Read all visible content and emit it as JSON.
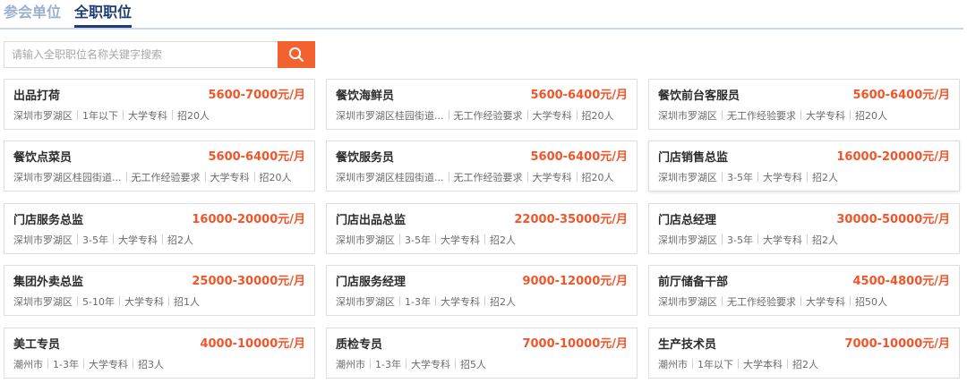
{
  "tabs": [
    {
      "label": "参会单位",
      "active": false
    },
    {
      "label": "全职职位",
      "active": true
    }
  ],
  "search": {
    "placeholder": "请输入全职职位名称关键字搜索",
    "icon": "search-icon"
  },
  "colors": {
    "accent": "#f2612f",
    "salary": "#f0562a",
    "tab_active": "#1f3d73",
    "tab_inactive": "#9bb0cf"
  },
  "jobs": [
    {
      "title": "出品打荷",
      "salary": "5600-7000元/月",
      "location": "深圳市罗湖区",
      "experience": "1年以下",
      "education": "大学专科",
      "headcount": "招20人"
    },
    {
      "title": "餐饮海鲜员",
      "salary": "5600-6400元/月",
      "location": "深圳市罗湖区桂园街道...",
      "experience": "无工作经验要求",
      "education": "大学专科",
      "headcount": "招20人"
    },
    {
      "title": "餐饮前台客服员",
      "salary": "5600-6400元/月",
      "location": "深圳市罗湖区",
      "experience": "无工作经验要求",
      "education": "大学专科",
      "headcount": "招20人"
    },
    {
      "title": "餐饮点菜员",
      "salary": "5600-6400元/月",
      "location": "深圳市罗湖区桂园街道...",
      "experience": "无工作经验要求",
      "education": "大学专科",
      "headcount": "招20人"
    },
    {
      "title": "餐饮服务员",
      "salary": "5600-6400元/月",
      "location": "深圳市罗湖区桂园街道...",
      "experience": "无工作经验要求",
      "education": "大学专科",
      "headcount": "招20人"
    },
    {
      "title": "门店销售总监",
      "salary": "16000-20000元/月",
      "location": "深圳市罗湖区",
      "experience": "3-5年",
      "education": "大学专科",
      "headcount": "招2人"
    },
    {
      "title": "门店服务总监",
      "salary": "16000-20000元/月",
      "location": "深圳市罗湖区",
      "experience": "3-5年",
      "education": "大学专科",
      "headcount": "招2人"
    },
    {
      "title": "门店出品总监",
      "salary": "22000-35000元/月",
      "location": "深圳市罗湖区",
      "experience": "3-5年",
      "education": "大学专科",
      "headcount": "招2人"
    },
    {
      "title": "门店总经理",
      "salary": "30000-50000元/月",
      "location": "深圳市罗湖区",
      "experience": "3-5年",
      "education": "大学专科",
      "headcount": "招2人"
    },
    {
      "title": "集团外卖总监",
      "salary": "25000-30000元/月",
      "location": "深圳市罗湖区",
      "experience": "5-10年",
      "education": "大学专科",
      "headcount": "招1人"
    },
    {
      "title": "门店服务经理",
      "salary": "9000-12000元/月",
      "location": "深圳市罗湖区",
      "experience": "1-3年",
      "education": "大学专科",
      "headcount": "招2人"
    },
    {
      "title": "前厅储备干部",
      "salary": "4500-4800元/月",
      "location": "深圳市罗湖区",
      "experience": "无工作经验要求",
      "education": "大学专科",
      "headcount": "招50人"
    },
    {
      "title": "美工专员",
      "salary": "4000-10000元/月",
      "location": "潮州市",
      "experience": "1-3年",
      "education": "大学专科",
      "headcount": "招3人"
    },
    {
      "title": "质检专员",
      "salary": "7000-10000元/月",
      "location": "潮州市",
      "experience": "1-3年",
      "education": "大学专科",
      "headcount": "招5人"
    },
    {
      "title": "生产技术员",
      "salary": "7000-10000元/月",
      "location": "潮州市",
      "experience": "1年以下",
      "education": "大学本科",
      "headcount": "招2人"
    }
  ]
}
